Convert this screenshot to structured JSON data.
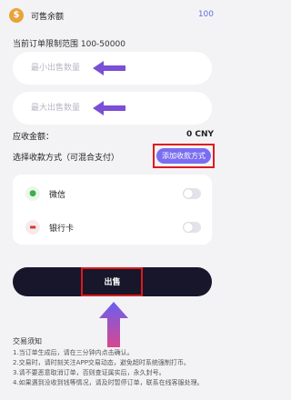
{
  "balance": {
    "icon": "coin-icon",
    "label": "可售余额",
    "value": "100"
  },
  "limit_text": "当前订单限制范围 100-50000",
  "inputs": {
    "min_placeholder": "最小出售数量",
    "max_placeholder": "最大出售数量"
  },
  "received": {
    "label": "应收金额：",
    "value": "0 CNY"
  },
  "payment": {
    "label": "选择收款方式（可混合支付）",
    "add_button": "添加收款方式",
    "methods": [
      {
        "icon": "wechat-icon",
        "name": "微信"
      },
      {
        "icon": "bank-card-icon",
        "name": "银行卡"
      }
    ]
  },
  "sell_button": "出售",
  "notes": {
    "title": "交易须知",
    "items": [
      "1.当订单生成后，请在三分钟内点击确认。",
      "2.交易时，请时刻关注APP交易动态，避免超时系统强制打币。",
      "3.请不要恶意取消订单，否则查证属实后，永久封号。",
      "4.如果遇到没收到钱等情况，请及时暂停订单，联系在线客服处理。"
    ]
  },
  "colors": {
    "accent": "#7a6df0",
    "highlight_frame": "#e0191d",
    "dark_button": "#17162a",
    "arrow": "#7b4fd6"
  }
}
